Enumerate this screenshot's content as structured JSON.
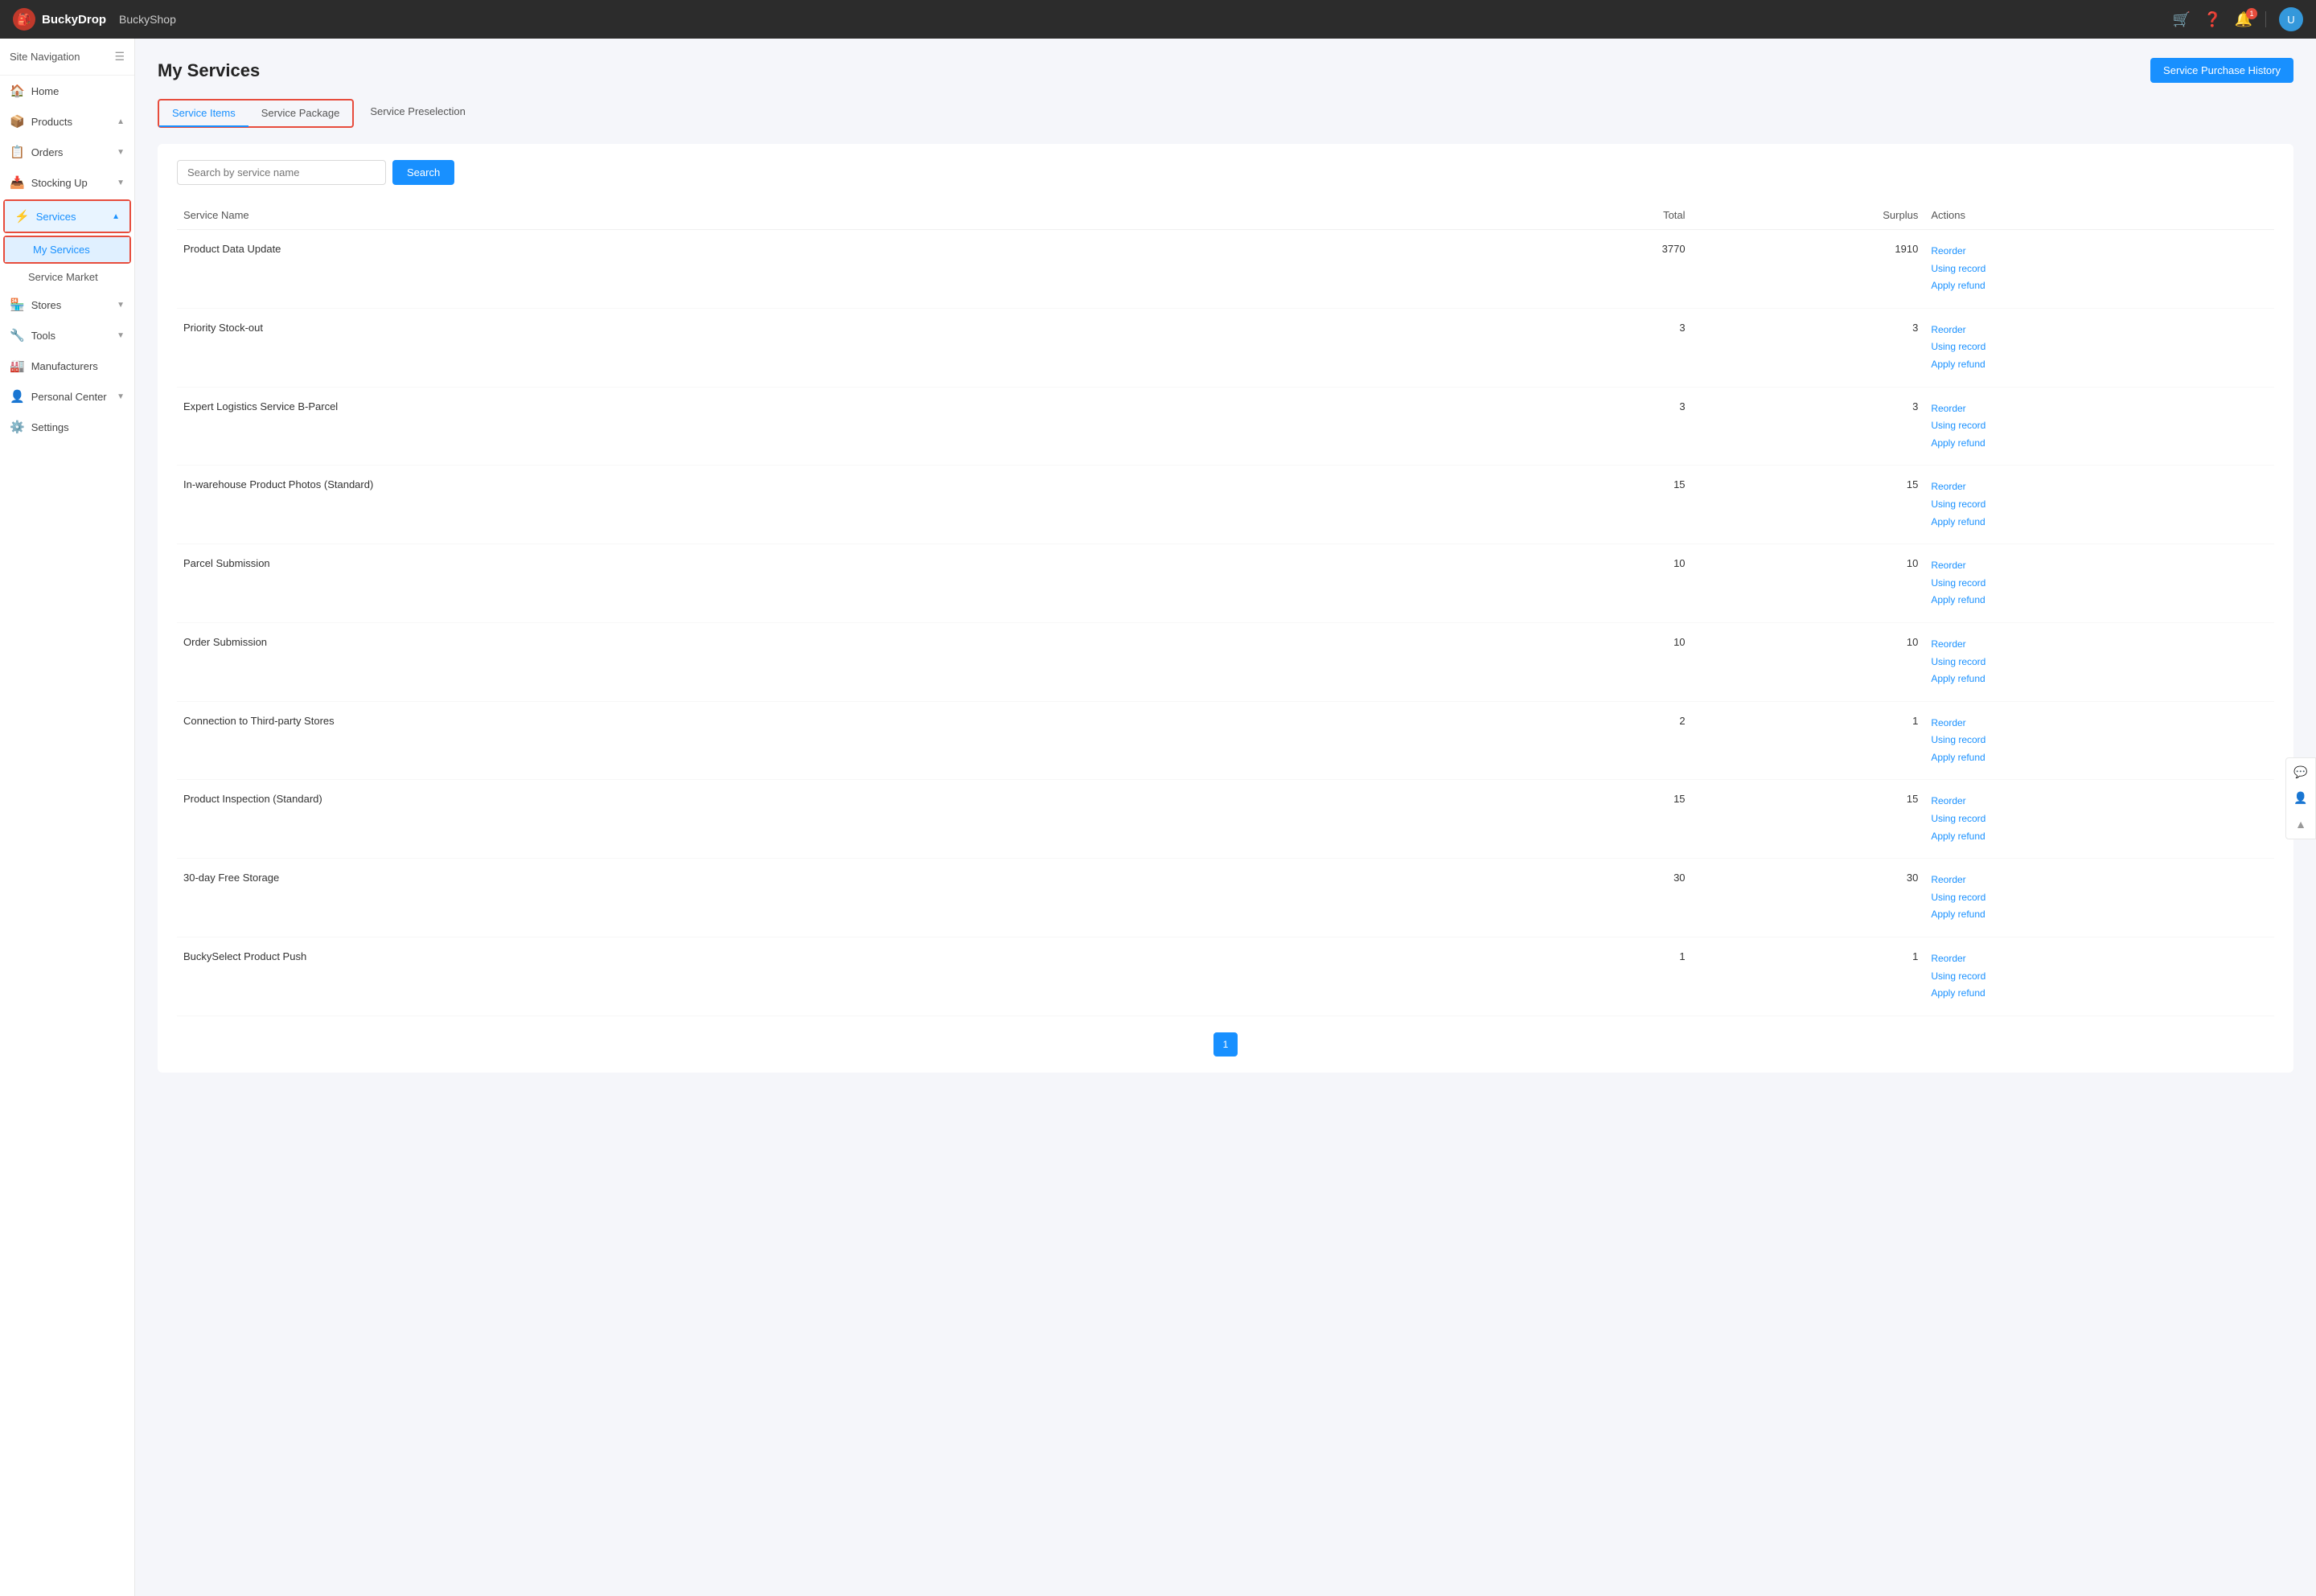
{
  "topnav": {
    "brand": "BuckyDrop",
    "appname": "BuckyShop",
    "logo_char": "🔴",
    "notification_count": "1",
    "avatar_char": "U"
  },
  "sidebar": {
    "header_label": "Site Navigation",
    "items": [
      {
        "id": "home",
        "label": "Home",
        "icon": "🏠",
        "has_arrow": false
      },
      {
        "id": "products",
        "label": "Products",
        "icon": "📦",
        "has_arrow": true
      },
      {
        "id": "orders",
        "label": "Orders",
        "icon": "📋",
        "has_arrow": true
      },
      {
        "id": "stocking-up",
        "label": "Stocking Up",
        "icon": "📥",
        "has_arrow": true
      },
      {
        "id": "services",
        "label": "Services",
        "icon": "⚡",
        "has_arrow": true,
        "active": true
      },
      {
        "id": "stores",
        "label": "Stores",
        "icon": "🏪",
        "has_arrow": true
      },
      {
        "id": "tools",
        "label": "Tools",
        "icon": "🔧",
        "has_arrow": true
      },
      {
        "id": "manufacturers",
        "label": "Manufacturers",
        "icon": "🏭",
        "has_arrow": false
      },
      {
        "id": "personal-center",
        "label": "Personal Center",
        "icon": "👤",
        "has_arrow": true
      },
      {
        "id": "settings",
        "label": "Settings",
        "icon": "⚙️",
        "has_arrow": false
      }
    ],
    "services_sub": [
      {
        "id": "my-services",
        "label": "My Services",
        "active": true
      },
      {
        "id": "service-market",
        "label": "Service Market",
        "active": false
      }
    ]
  },
  "page": {
    "title": "My Services",
    "history_button": "Service Purchase History"
  },
  "tabs": [
    {
      "id": "service-items",
      "label": "Service Items",
      "active": true
    },
    {
      "id": "service-package",
      "label": "Service Package",
      "active": false
    },
    {
      "id": "service-preselection",
      "label": "Service Preselection",
      "active": false
    }
  ],
  "search": {
    "placeholder": "Search by service name",
    "button_label": "Search"
  },
  "table": {
    "headers": {
      "name": "Service Name",
      "total": "Total",
      "surplus": "Surplus",
      "actions": "Actions"
    },
    "rows": [
      {
        "name": "Product Data Update",
        "total": "3770",
        "surplus": "1910",
        "actions": [
          "Reorder",
          "Using record",
          "Apply refund"
        ]
      },
      {
        "name": "Priority Stock-out",
        "total": "3",
        "surplus": "3",
        "actions": [
          "Reorder",
          "Using record",
          "Apply refund"
        ]
      },
      {
        "name": "Expert Logistics Service B-Parcel",
        "total": "3",
        "surplus": "3",
        "actions": [
          "Reorder",
          "Using record",
          "Apply refund"
        ]
      },
      {
        "name": "In-warehouse Product Photos (Standard)",
        "total": "15",
        "surplus": "15",
        "actions": [
          "Reorder",
          "Using record",
          "Apply refund"
        ]
      },
      {
        "name": "Parcel Submission",
        "total": "10",
        "surplus": "10",
        "actions": [
          "Reorder",
          "Using record",
          "Apply refund"
        ]
      },
      {
        "name": "Order Submission",
        "total": "10",
        "surplus": "10",
        "actions": [
          "Reorder",
          "Using record",
          "Apply refund"
        ]
      },
      {
        "name": "Connection to Third-party Stores",
        "total": "2",
        "surplus": "1",
        "actions": [
          "Reorder",
          "Using record",
          "Apply refund"
        ]
      },
      {
        "name": "Product Inspection (Standard)",
        "total": "15",
        "surplus": "15",
        "actions": [
          "Reorder",
          "Using record",
          "Apply refund"
        ]
      },
      {
        "name": "30-day Free Storage",
        "total": "30",
        "surplus": "30",
        "actions": [
          "Reorder",
          "Using record",
          "Apply refund"
        ]
      },
      {
        "name": "BuckySelect Product Push",
        "total": "1",
        "surplus": "1",
        "actions": [
          "Reorder",
          "Using record",
          "Apply refund"
        ]
      }
    ]
  },
  "pagination": {
    "current": 1,
    "pages": [
      1
    ]
  }
}
